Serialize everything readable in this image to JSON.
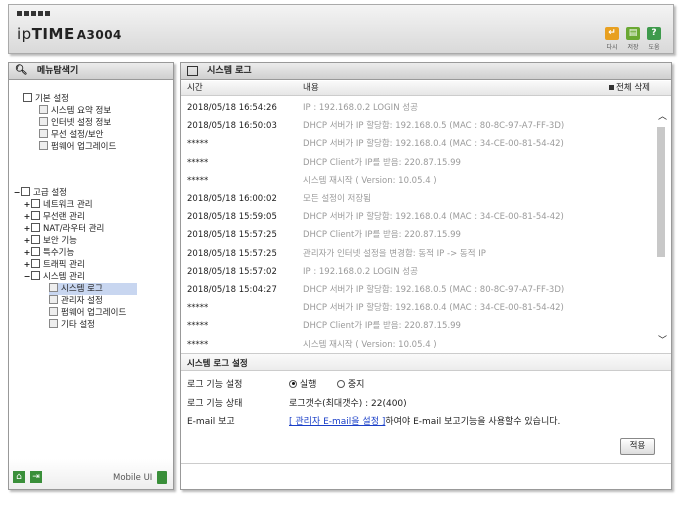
{
  "header": {
    "brand_ip": "ip",
    "brand_time": "TIME",
    "model": "A3004",
    "buttons": [
      {
        "label": "다시",
        "color": "#e8a020",
        "glyph": "↵"
      },
      {
        "label": "저장",
        "color": "#6aa832",
        "glyph": "▤"
      },
      {
        "label": "도움",
        "color": "#3e9a4c",
        "glyph": "?"
      }
    ]
  },
  "sidebar": {
    "title": "메뉴탐색기",
    "basic": {
      "label": "기본 설정",
      "items": [
        "시스템 요약 정보",
        "인터넷 설정 정보",
        "무선 설정/보안",
        "펌웨어 업그레이드"
      ]
    },
    "advanced": {
      "label": "고급 설정",
      "items": [
        "네트워크 관리",
        "무선랜 관리",
        "NAT/라우터 관리",
        "보안 기능",
        "특수기능",
        "트래픽 관리",
        "시스템 관리"
      ],
      "system_children": [
        "시스템 로그",
        "관리자 설정",
        "펌웨어 업그레이드",
        "기타 설정"
      ]
    },
    "mobile_label": "Mobile UI"
  },
  "main": {
    "title": "시스템 로그",
    "columns": {
      "time": "시간",
      "content": "내용",
      "delete_all": "전체 삭제"
    },
    "logs": [
      {
        "time": "2018/05/18 16:54:26",
        "content": "IP : 192.168.0.2 LOGIN 성공"
      },
      {
        "time": "2018/05/18 16:50:03",
        "content": "DHCP 서버가 IP 할당함: 192.168.0.5 (MAC : 80-8C-97-A7-FF-3D)"
      },
      {
        "time": "*****",
        "content": "DHCP 서버가 IP 할당함: 192.168.0.4 (MAC : 34-CE-00-81-54-42)"
      },
      {
        "time": "*****",
        "content": "DHCP Client가 IP를 받음: 220.87.15.99"
      },
      {
        "time": "*****",
        "content": "시스템 재시작 ( Version: 10.05.4 )"
      },
      {
        "time": "2018/05/18 16:00:02",
        "content": "모든 설정이 저장됨"
      },
      {
        "time": "2018/05/18 15:59:05",
        "content": "DHCP 서버가 IP 할당함: 192.168.0.4 (MAC : 34-CE-00-81-54-42)"
      },
      {
        "time": "2018/05/18 15:57:25",
        "content": "DHCP Client가 IP를 받음: 220.87.15.99"
      },
      {
        "time": "2018/05/18 15:57:25",
        "content": "관리자가 인터넷 설정을 변경함: 동적 IP -> 동적 IP"
      },
      {
        "time": "2018/05/18 15:57:02",
        "content": "IP : 192.168.0.2 LOGIN 성공"
      },
      {
        "time": "2018/05/18 15:04:27",
        "content": "DHCP 서버가 IP 할당함: 192.168.0.5 (MAC : 80-8C-97-A7-FF-3D)"
      },
      {
        "time": "*****",
        "content": "DHCP 서버가 IP 할당함: 192.168.0.4 (MAC : 34-CE-00-81-54-42)"
      },
      {
        "time": "*****",
        "content": "DHCP Client가 IP를 받음: 220.87.15.99"
      },
      {
        "time": "*****",
        "content": "시스템 재시작 ( Version: 10.05.4 )"
      }
    ],
    "settings": {
      "title": "시스템 로그 설정",
      "function_label": "로그 기능 설정",
      "opt_on": "실행",
      "opt_off": "중지",
      "status_label": "로그 기능 상태",
      "status_value": "로그갯수(최대갯수) : 22(400)",
      "email_label": "E-mail 보고",
      "email_link": "[ 관리자 E-mail을 설정 ]",
      "email_text": "하여야 E-mail 보고기능을 사용할수 있습니다.",
      "apply": "적용"
    }
  }
}
